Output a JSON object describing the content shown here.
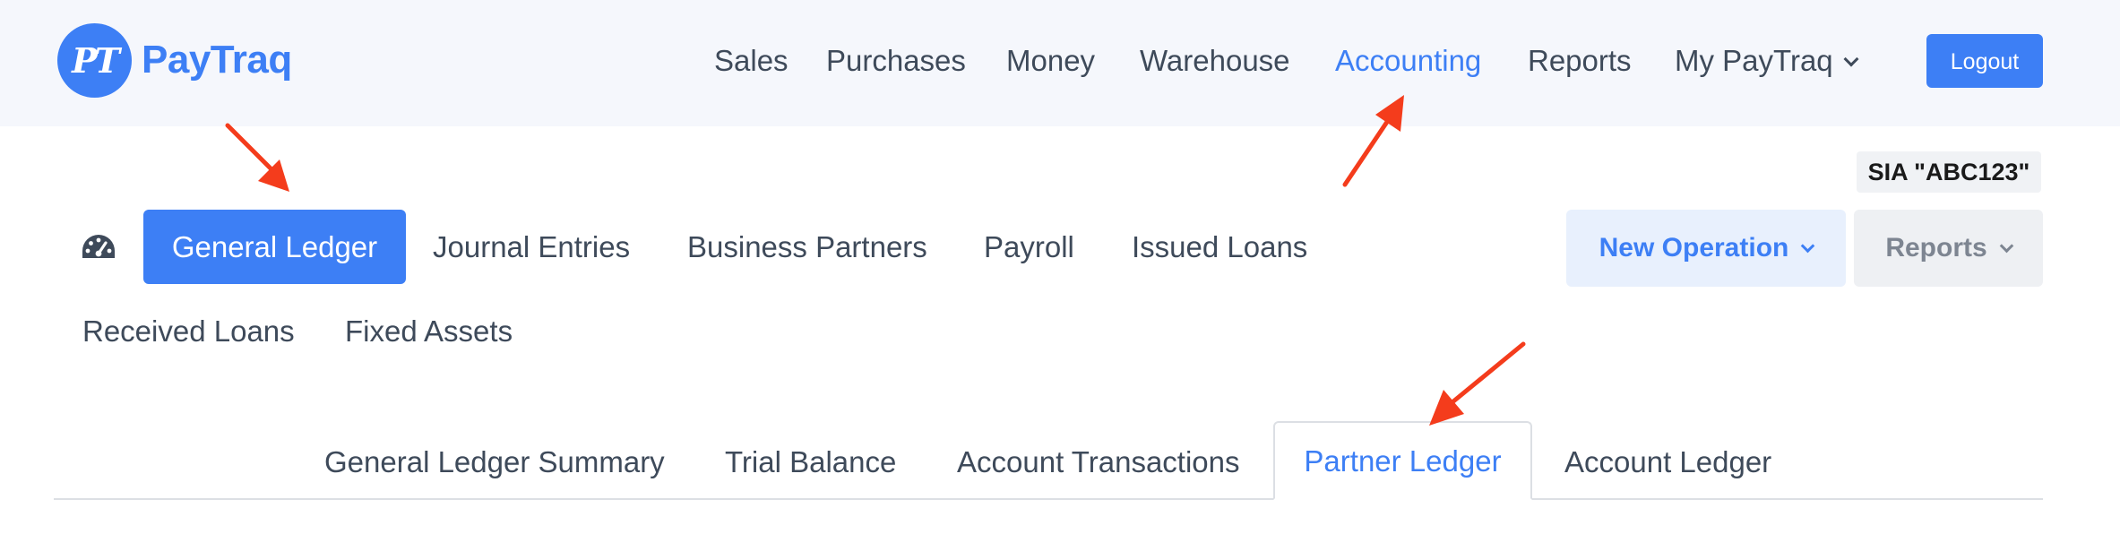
{
  "brand": {
    "logo_monogram": "PT",
    "name": "PayTraq",
    "accent_color": "#3d7ff5"
  },
  "topnav": {
    "items": [
      {
        "label": "Sales"
      },
      {
        "label": "Purchases"
      },
      {
        "label": "Money"
      },
      {
        "label": "Warehouse"
      },
      {
        "label": "Accounting",
        "active": true
      },
      {
        "label": "Reports"
      },
      {
        "label": "My PayTraq",
        "has_dropdown": true
      }
    ],
    "logout_label": "Logout"
  },
  "company": {
    "name": "SIA \"ABC123\""
  },
  "subnav": {
    "dashboard_icon": "speedometer-icon",
    "active_label": "General Ledger",
    "items": [
      {
        "label": "Journal Entries"
      },
      {
        "label": "Business Partners"
      },
      {
        "label": "Payroll"
      },
      {
        "label": "Issued Loans"
      },
      {
        "label": "Received Loans"
      },
      {
        "label": "Fixed Assets"
      }
    ],
    "new_operation_label": "New Operation",
    "reports_label": "Reports"
  },
  "tabs": {
    "items": [
      {
        "label": "General Ledger Summary"
      },
      {
        "label": "Trial Balance"
      },
      {
        "label": "Account Transactions"
      },
      {
        "label": "Partner Ledger",
        "active": true
      },
      {
        "label": "Account Ledger"
      }
    ]
  },
  "annotation_color": "#f43c1c"
}
